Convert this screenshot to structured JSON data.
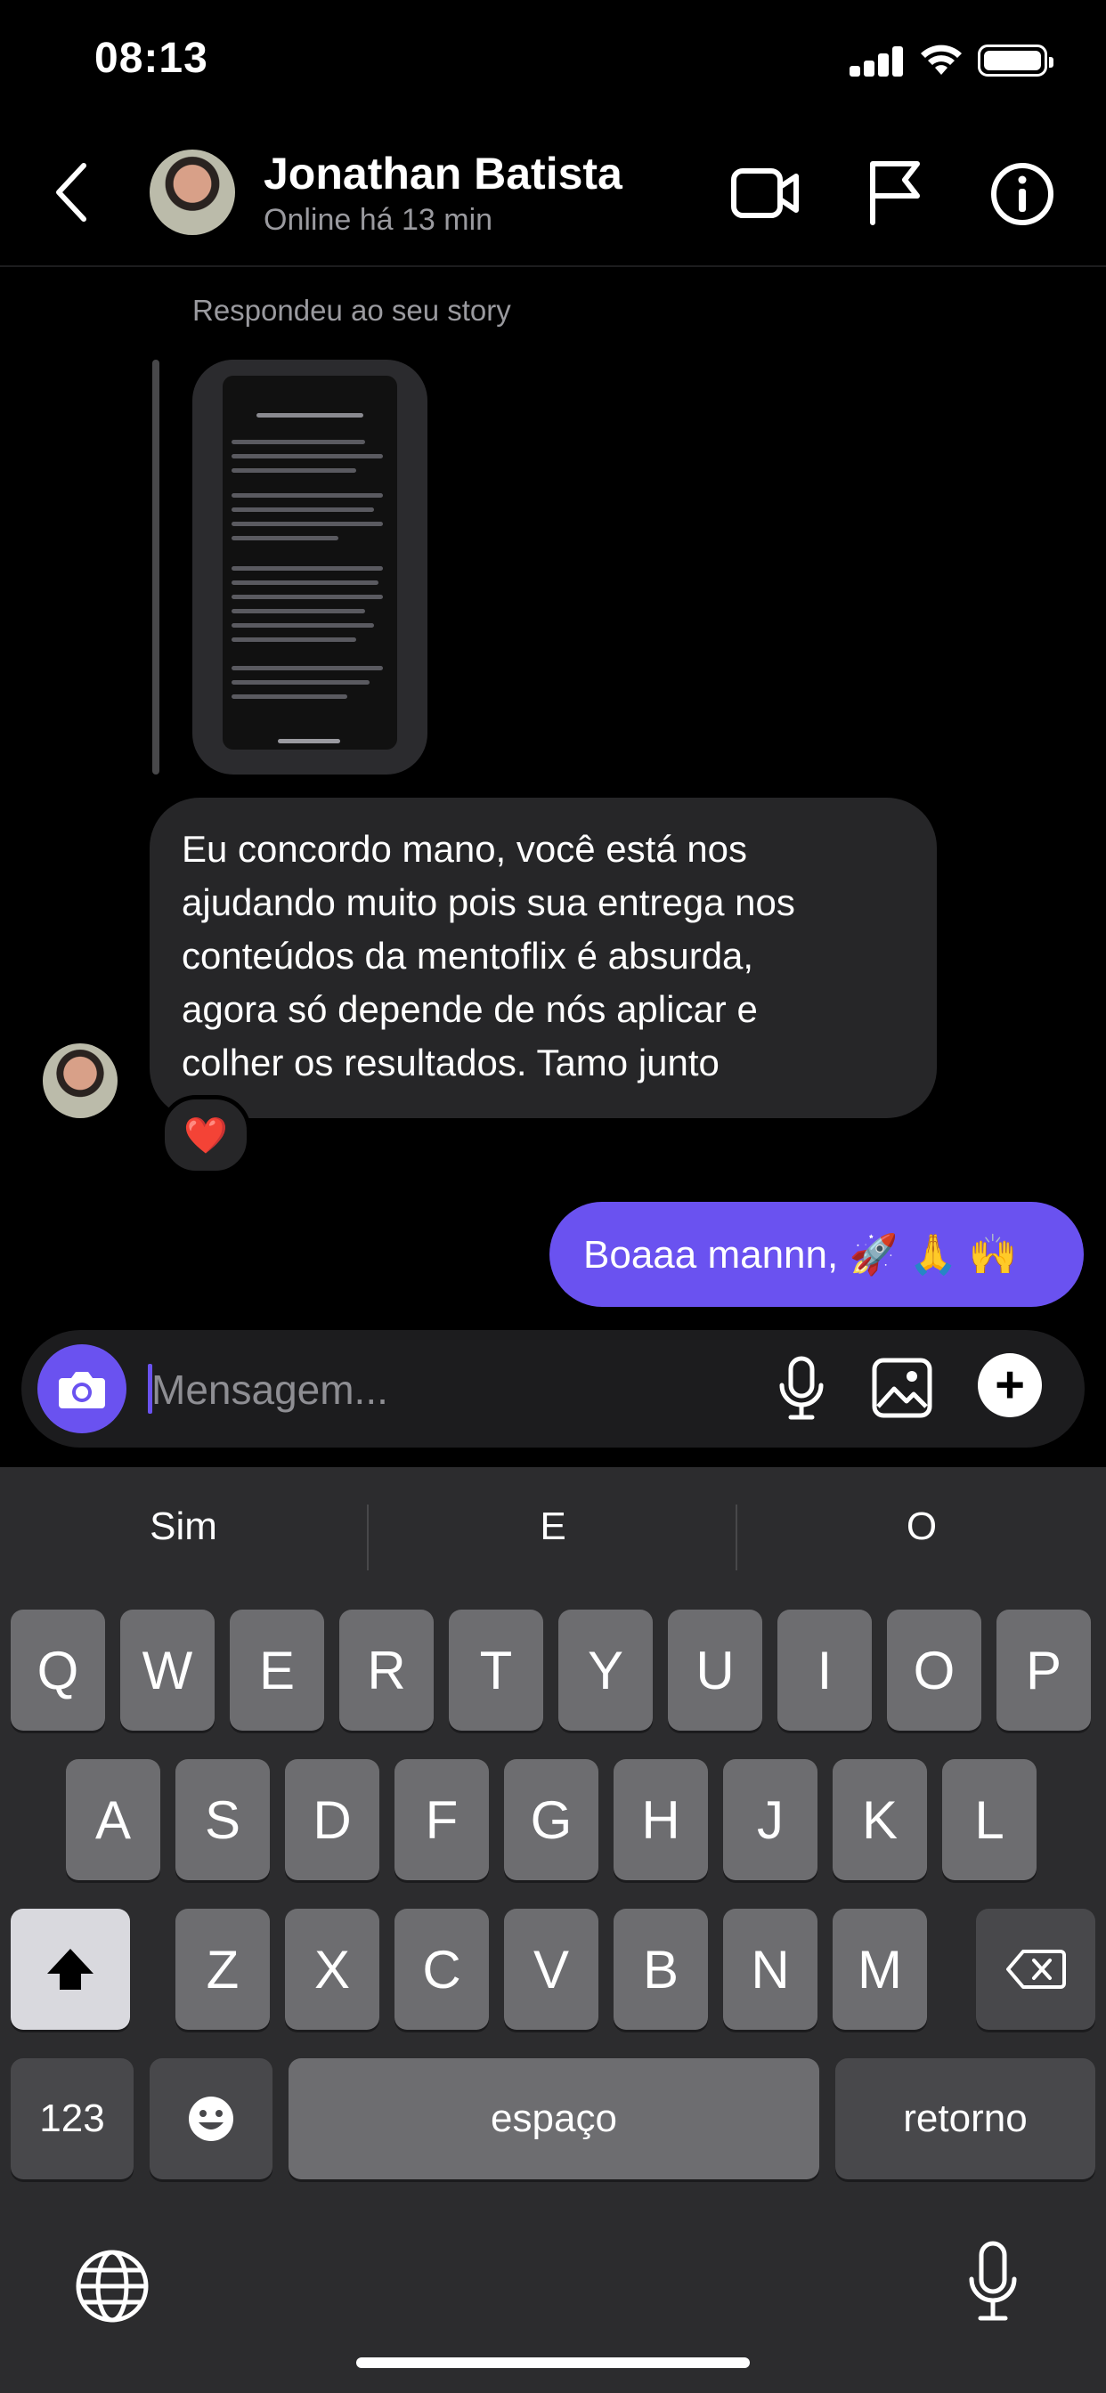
{
  "status_bar": {
    "time": "08:13"
  },
  "header": {
    "contact_name": "Jonathan Batista",
    "contact_status": "Online há 13 min",
    "icons": [
      "back-chevron-icon",
      "video-camera-icon",
      "flag-icon",
      "info-icon"
    ]
  },
  "chat": {
    "story_reply_caption": "Respondeu ao seu story",
    "incoming": {
      "lines": [
        "Eu concordo mano, você está nos",
        "ajudando muito pois sua entrega nos",
        "conteúdos da mentoflix é absurda,",
        "agora só depende de nós aplicar e",
        "colher os resultados. Tamo junto"
      ],
      "reaction": "❤️"
    },
    "outgoing": {
      "text": "Boaaa mannn, 🚀 🙏 🙌"
    }
  },
  "composer": {
    "placeholder": "Mensagem..."
  },
  "keyboard": {
    "suggestions": [
      "Sim",
      "E",
      "O"
    ],
    "row1": [
      "Q",
      "W",
      "E",
      "R",
      "T",
      "Y",
      "U",
      "I",
      "O",
      "P"
    ],
    "row2": [
      "A",
      "S",
      "D",
      "F",
      "G",
      "H",
      "J",
      "K",
      "L"
    ],
    "row3": [
      "Z",
      "X",
      "C",
      "V",
      "B",
      "N",
      "M"
    ],
    "numbers_label": "123",
    "space_label": "espaço",
    "return_label": "retorno"
  },
  "colors": {
    "accent": "#6a52f0",
    "bubble_incoming": "#262628",
    "keyboard_bg": "#2c2c2e"
  }
}
